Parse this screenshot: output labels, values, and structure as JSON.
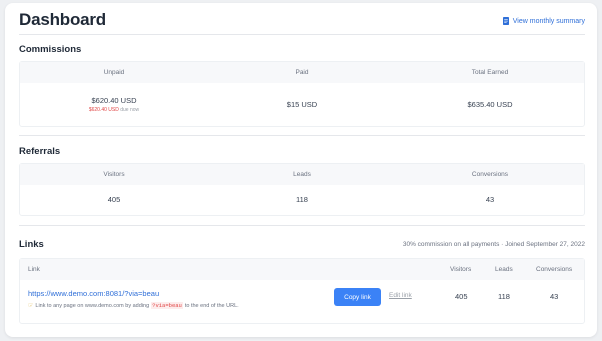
{
  "header": {
    "title": "Dashboard",
    "summary_link": "View monthly summary",
    "summary_icon": "document-icon"
  },
  "commissions": {
    "title": "Commissions",
    "columns": [
      "Unpaid",
      "Paid",
      "Total Earned"
    ],
    "unpaid": "$620.40 USD",
    "due_amount": "$620.40 USD",
    "due_label": "due now",
    "paid": "$15 USD",
    "total": "$635.40 USD"
  },
  "referrals": {
    "title": "Referrals",
    "columns": [
      "Visitors",
      "Leads",
      "Conversions"
    ],
    "values": [
      "405",
      "118",
      "43"
    ]
  },
  "links": {
    "title": "Links",
    "meta_commission": "30% commission on all payments",
    "meta_sep": "·",
    "meta_joined": "Joined September 27, 2022",
    "columns": {
      "link": "Link",
      "visitors": "Visitors",
      "leads": "Leads",
      "conversions": "Conversions"
    },
    "row": {
      "url": "https://www.demo.com:8081/?via=beau",
      "hint_prefix": "Link to any page on www.demo.com by adding",
      "hint_code": "?via=beau",
      "hint_suffix": "to the end of the URL.",
      "copy_label": "Copy link",
      "edit_label": "Edit link",
      "visitors": "405",
      "leads": "118",
      "conversions": "43"
    }
  },
  "colors": {
    "accent": "#3b82f6",
    "link": "#2f6fd8",
    "danger": "#e04545"
  }
}
